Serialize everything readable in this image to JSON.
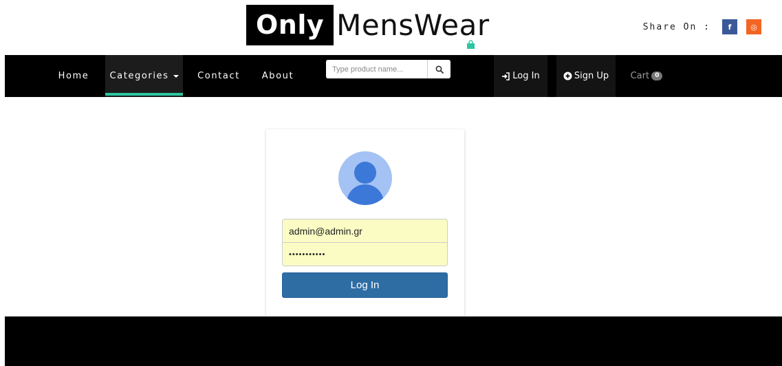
{
  "logo": {
    "part1": "Only",
    "part2": "MensWear"
  },
  "share": {
    "label": "Share On :",
    "facebook_glyph": "f",
    "instagram_glyph": "◎"
  },
  "nav": {
    "home": "Home",
    "categories": "Categories",
    "contact": "Contact",
    "about": "About",
    "search_placeholder": "Type product name...",
    "login": "Log In",
    "signup": "Sign Up",
    "cart": "Cart",
    "cart_count": "0"
  },
  "login_form": {
    "email_value": "admin@admin.gr",
    "password_value": "•••••••••••",
    "submit_label": "Log In"
  },
  "colors": {
    "accent_underline": "#2cc5a0",
    "button_primary": "#2e6da4",
    "autofill_bg": "#fafcc3",
    "avatar_light": "#a4c2f4",
    "avatar_dark": "#3c78d8",
    "facebook": "#3b5998",
    "instagram": "#f26522"
  }
}
